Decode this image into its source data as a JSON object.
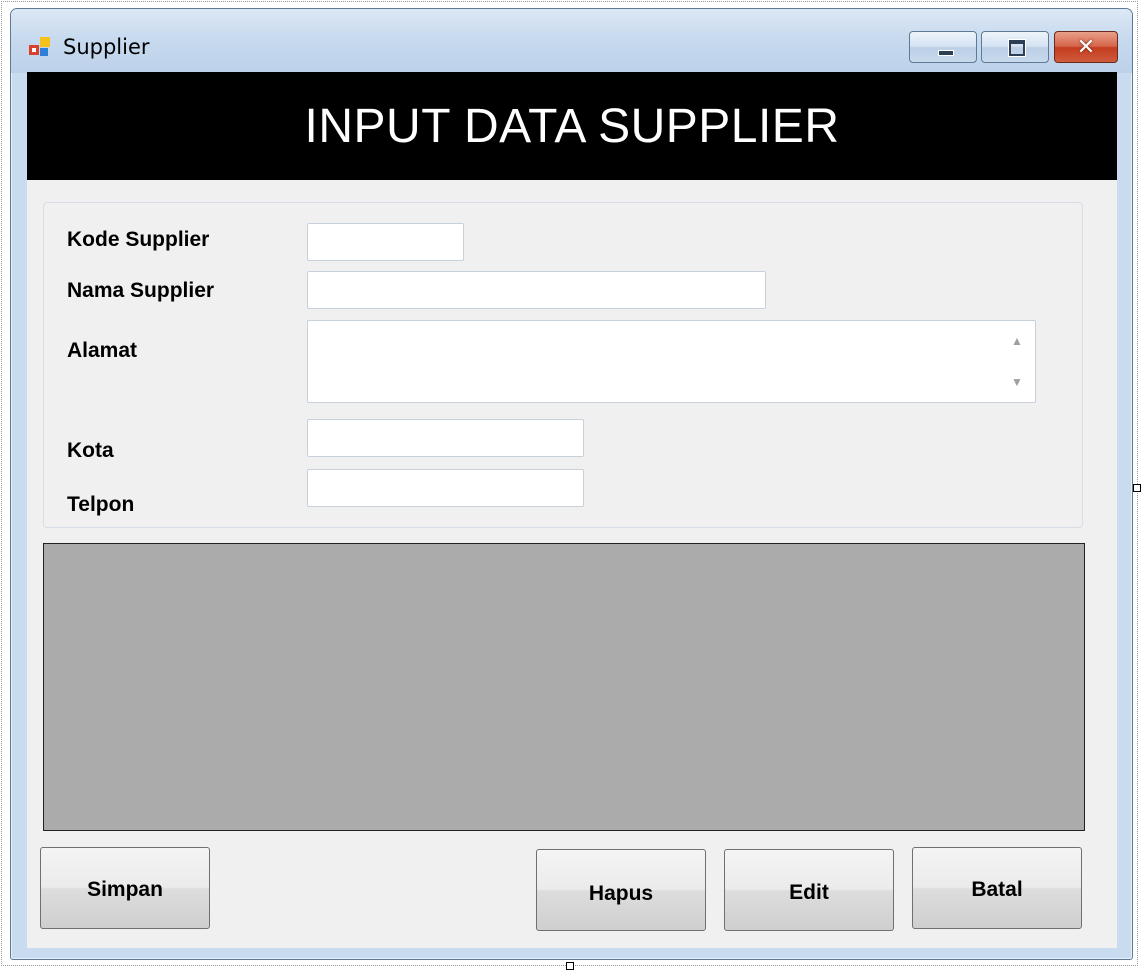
{
  "window": {
    "title": "Supplier",
    "close_glyph": "✕"
  },
  "header": {
    "title": "INPUT DATA SUPPLIER"
  },
  "form": {
    "kode_supplier": {
      "label": "Kode Supplier",
      "value": ""
    },
    "nama_supplier": {
      "label": "Nama Supplier",
      "value": ""
    },
    "alamat": {
      "label": "Alamat",
      "value": ""
    },
    "kota": {
      "label": "Kota",
      "value": ""
    },
    "telpon": {
      "label": "Telpon",
      "value": ""
    }
  },
  "buttons": {
    "simpan": "Simpan",
    "hapus": "Hapus",
    "edit": "Edit",
    "batal": "Batal"
  },
  "colors": {
    "header_bg": "#000000",
    "header_text": "#ffffff",
    "grid_bg": "#ababab",
    "form_bg": "#f0f0f0"
  },
  "icons": {
    "app": "windows-form-icon",
    "minimize": "minimize-icon",
    "maximize": "maximize-icon",
    "close": "close-icon",
    "scroll_up": "scroll-up-arrow-icon",
    "scroll_down": "scroll-down-arrow-icon"
  }
}
